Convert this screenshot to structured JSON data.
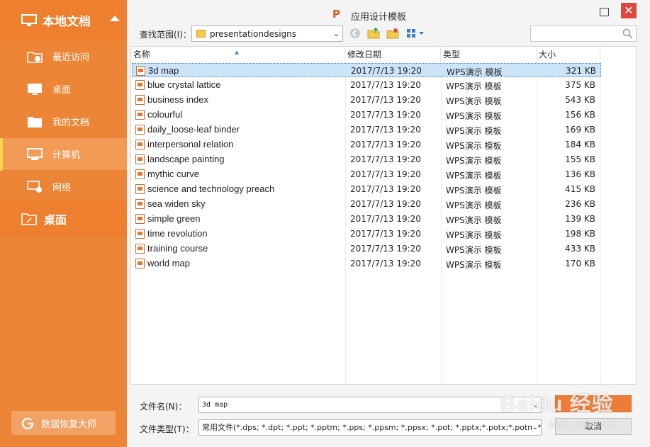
{
  "sidebar": {
    "header": "本地文档",
    "items": [
      {
        "label": "最近访问",
        "icon": "recent-folder-icon"
      },
      {
        "label": "桌面",
        "icon": "desktop-monitor-icon"
      },
      {
        "label": "我的文档",
        "icon": "my-documents-folder-icon"
      },
      {
        "label": "计算机",
        "icon": "computer-icon"
      },
      {
        "label": "网络",
        "icon": "network-icon"
      }
    ],
    "active_index": 3,
    "section2": "桌面",
    "recover_label": "数据恢复大师"
  },
  "window": {
    "logo_glyph": "P",
    "title": "应用设计模板",
    "close_glyph": "✕"
  },
  "toolbar": {
    "lookin_label": "查找范围(I)：",
    "path": "presentationdesigns",
    "dropdown_glyph": "⌄",
    "search_placeholder": ""
  },
  "columns": {
    "name": "名称",
    "date": "修改日期",
    "type": "类型",
    "size": "大小"
  },
  "files": [
    {
      "name": "3d map",
      "date": "2017/7/13 19:20",
      "type": "WPS演示 模板",
      "size": "321 KB"
    },
    {
      "name": "blue crystal lattice",
      "date": "2017/7/13 19:20",
      "type": "WPS演示 模板",
      "size": "375 KB"
    },
    {
      "name": "business index",
      "date": "2017/7/13 19:20",
      "type": "WPS演示 模板",
      "size": "543 KB"
    },
    {
      "name": "colourful",
      "date": "2017/7/13 19:20",
      "type": "WPS演示 模板",
      "size": "156 KB"
    },
    {
      "name": "daily_loose-leaf binder",
      "date": "2017/7/13 19:20",
      "type": "WPS演示 模板",
      "size": "169 KB"
    },
    {
      "name": "interpersonal relation",
      "date": "2017/7/13 19:20",
      "type": "WPS演示 模板",
      "size": "184 KB"
    },
    {
      "name": "landscape painting",
      "date": "2017/7/13 19:20",
      "type": "WPS演示 模板",
      "size": "155 KB"
    },
    {
      "name": "mythic curve",
      "date": "2017/7/13 19:20",
      "type": "WPS演示 模板",
      "size": "136 KB"
    },
    {
      "name": "science and technology preach",
      "date": "2017/7/13 19:20",
      "type": "WPS演示 模板",
      "size": "415 KB"
    },
    {
      "name": "sea widen sky",
      "date": "2017/7/13 19:20",
      "type": "WPS演示 模板",
      "size": "236 KB"
    },
    {
      "name": "simple green",
      "date": "2017/7/13 19:20",
      "type": "WPS演示 模板",
      "size": "139 KB"
    },
    {
      "name": "time revolution",
      "date": "2017/7/13 19:20",
      "type": "WPS演示 模板",
      "size": "198 KB"
    },
    {
      "name": "training course",
      "date": "2017/7/13 19:20",
      "type": "WPS演示 模板",
      "size": "433 KB"
    },
    {
      "name": "world map",
      "date": "2017/7/13 19:20",
      "type": "WPS演示 模板",
      "size": "170 KB"
    }
  ],
  "selected_index": 0,
  "form": {
    "filename_label": "文件名(N)：",
    "filename_value": "3d map",
    "filetype_label": "文件类型(T)：",
    "filetype_value": "常用文件(*.dps; *.dpt; *.ppt; *.pptm; *.pps; *.ppsm; *.ppsx; *.pot; *.pptx;*.potx;*.potm;*.ti",
    "open_label": "",
    "cancel_label": "取消"
  },
  "watermark": {
    "text": "Baidu 经验",
    "url": "jingyan.baidu.com"
  },
  "colors": {
    "sidebar": "#ed8536",
    "accent": "#ec7c36",
    "selection": "#cce4f7",
    "close": "#e0473c"
  }
}
